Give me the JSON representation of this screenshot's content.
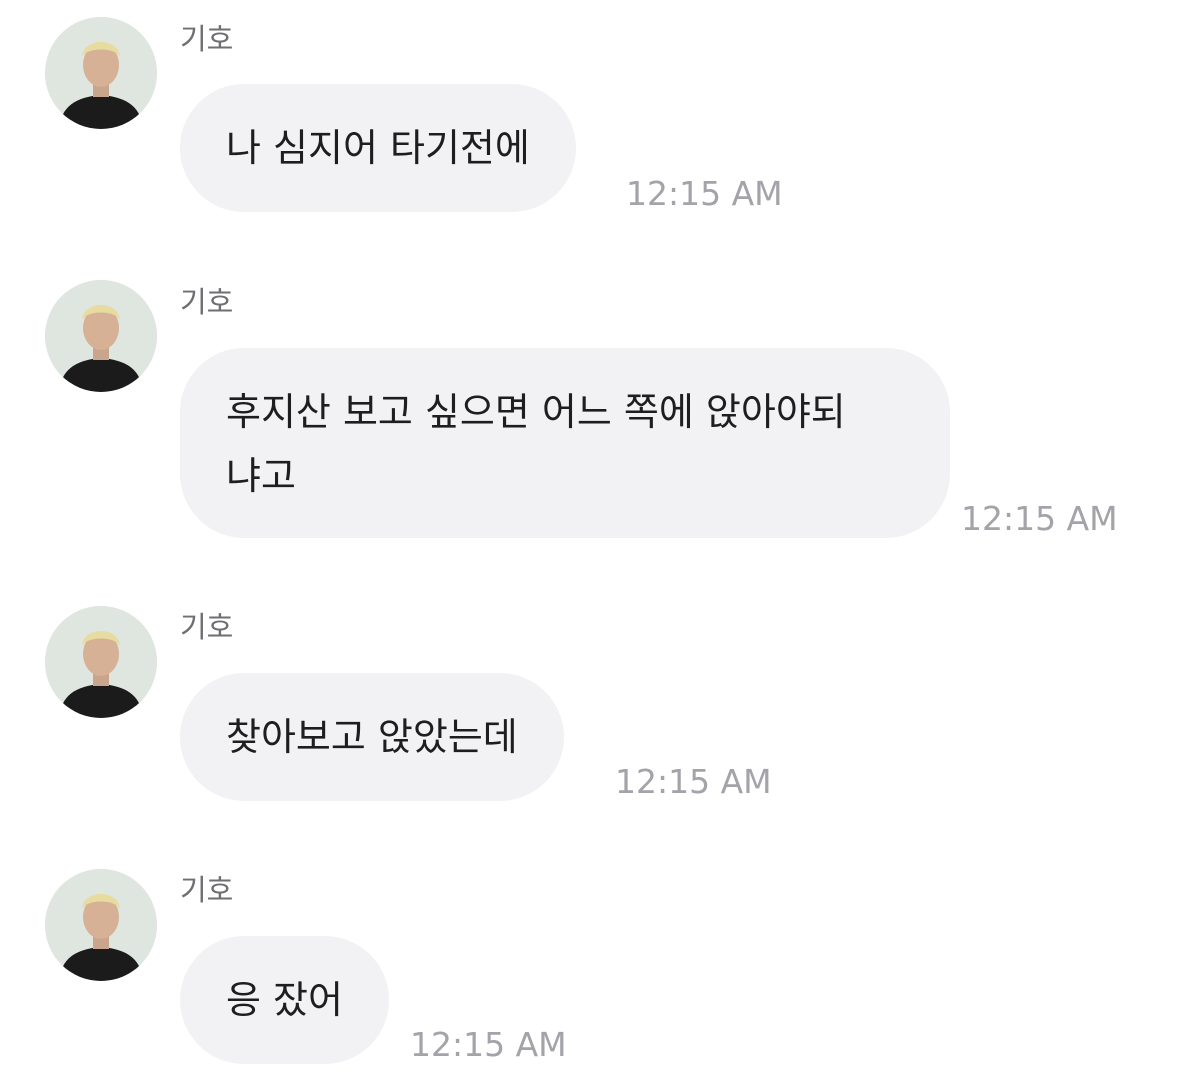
{
  "colors": {
    "bubble_background": "#f2f2f5",
    "message_text": "#1e1e1e",
    "sender_text": "#6e6e73",
    "timestamp_text": "#a3a3aa"
  },
  "messages": [
    {
      "sender": "기호",
      "text": "나 심지어 타기전에",
      "time": "12:15 AM"
    },
    {
      "sender": "기호",
      "text": "후지산 보고 싶으면 어느 쪽에 앉아야되\n냐고",
      "time": "12:15 AM"
    },
    {
      "sender": "기호",
      "text": "찾아보고 앉았는데",
      "time": "12:15 AM"
    },
    {
      "sender": "기호",
      "text": "응 잤어",
      "time": "12:15 AM"
    }
  ]
}
